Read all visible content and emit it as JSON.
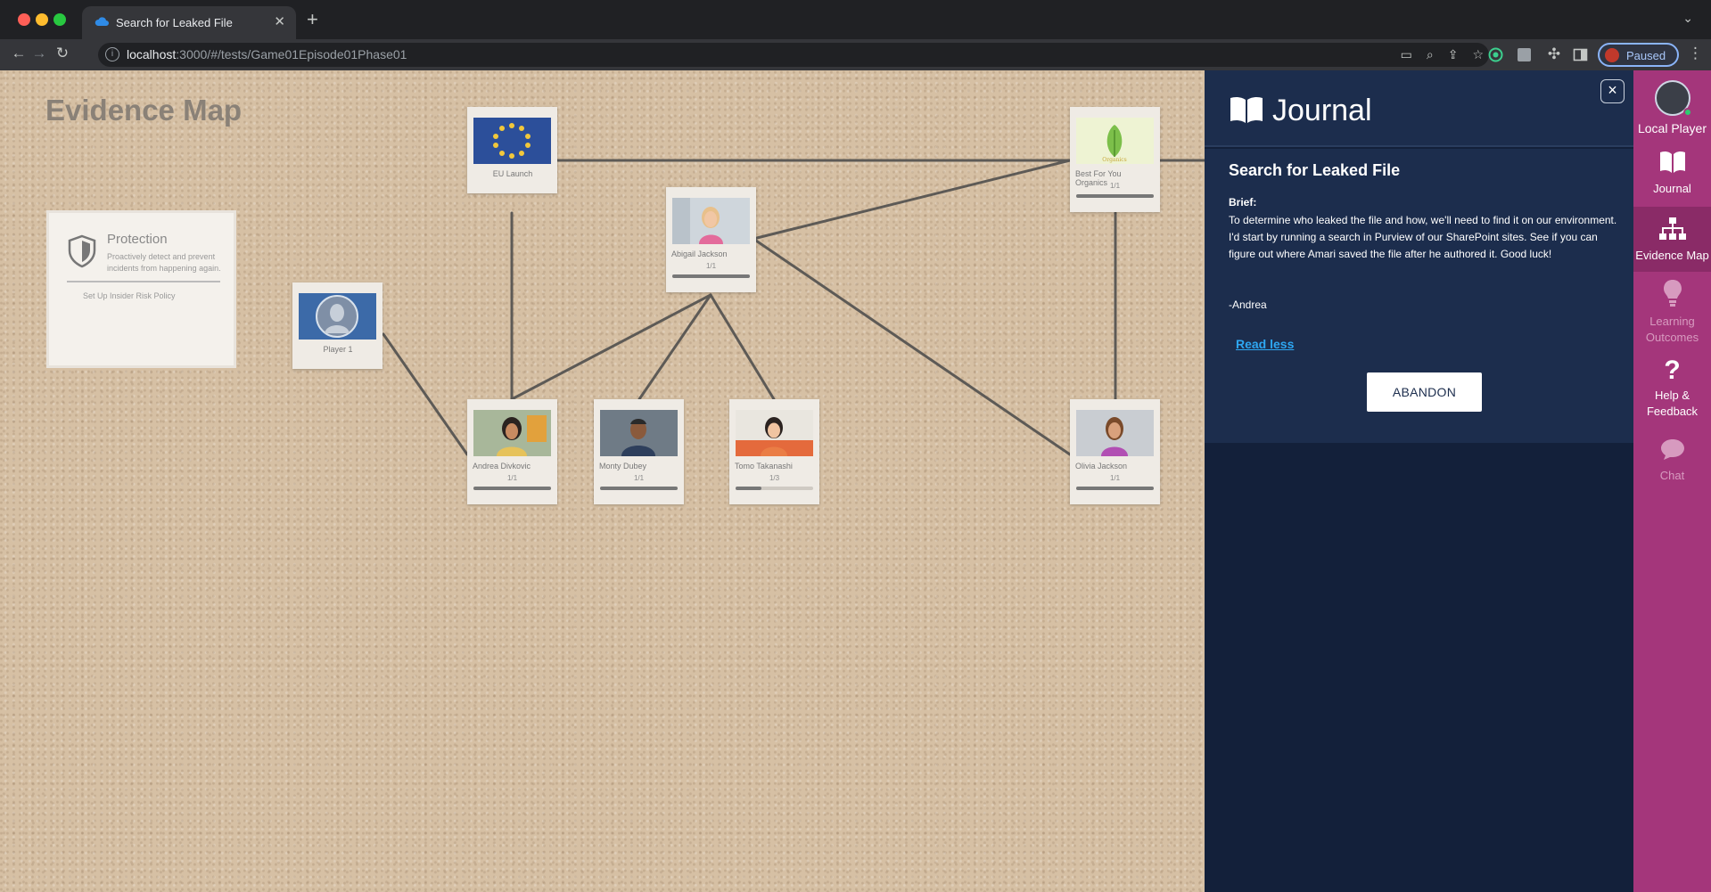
{
  "browser": {
    "tab_title": "Search for Leaked File",
    "new_tab": "+",
    "url_host": "localhost",
    "url_rest": ":3000/#/tests/Game01Episode01Phase01",
    "profile_status": "Paused"
  },
  "board": {
    "title": "Evidence Map",
    "protection": {
      "title": "Protection",
      "description": "Proactively detect and prevent incidents from happening again.",
      "link": "Set Up Insider Risk Policy"
    },
    "cards": [
      {
        "id": "eu",
        "name": "EU Launch",
        "count": "",
        "progress": null
      },
      {
        "id": "abigail",
        "name": "Abigail Jackson",
        "count": "1/1",
        "progress": 1.0
      },
      {
        "id": "bfyo",
        "name": "Best For You Organics",
        "count": "1/1",
        "progress": 1.0
      },
      {
        "id": "player",
        "name": "Player 1",
        "count": "",
        "progress": null
      },
      {
        "id": "andrea",
        "name": "Andrea Divkovic",
        "count": "1/1",
        "progress": 1.0
      },
      {
        "id": "monty",
        "name": "Monty Dubey",
        "count": "1/1",
        "progress": 1.0
      },
      {
        "id": "tomo",
        "name": "Tomo Takanashi",
        "count": "1/3",
        "progress": 0.33
      },
      {
        "id": "olivia",
        "name": "Olivia Jackson",
        "count": "1/1",
        "progress": 1.0
      }
    ]
  },
  "journal": {
    "title": "Journal",
    "close": "×",
    "quest_title": "Search for Leaked File",
    "brief_label": "Brief:",
    "brief_text": "To determine who leaked the file and how, we'll need to find it on our environment. I'd start by running a search in Purview of our SharePoint sites. See if you can figure out where Amari saved the file after he authored it. Good luck!",
    "signature": "-Andrea",
    "read_less": "Read less",
    "abandon": "ABANDON"
  },
  "nav": {
    "player": "Local Player",
    "items": [
      {
        "label": "Journal",
        "icon": "book-icon"
      },
      {
        "label": "Evidence Map",
        "icon": "hierarchy-icon"
      },
      {
        "label": "Learning Outcomes",
        "icon": "lightbulb-icon"
      },
      {
        "label": "Help & Feedback",
        "icon": "question-icon"
      },
      {
        "label": "Chat",
        "icon": "chat-bubble-icon"
      }
    ]
  }
}
